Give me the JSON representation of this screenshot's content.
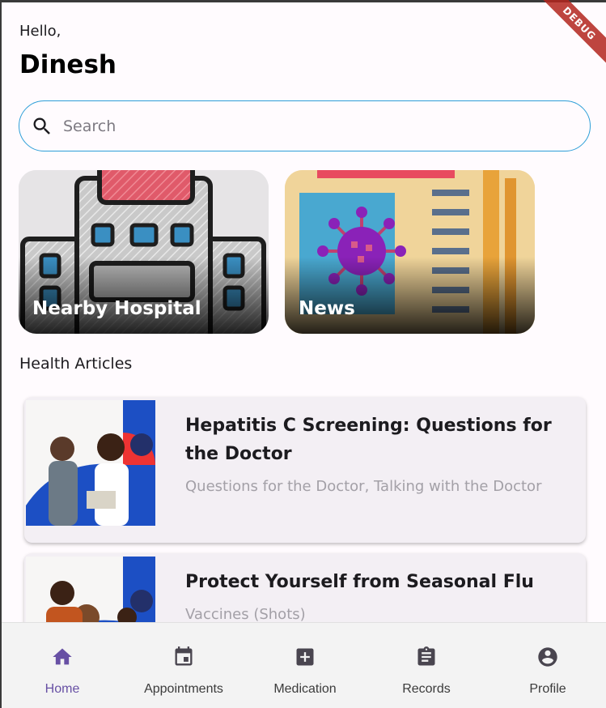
{
  "header": {
    "greeting": "Hello,",
    "name": "Dinesh",
    "debug_banner": "DEBUG"
  },
  "search": {
    "placeholder": "Search",
    "value": ""
  },
  "quick_links": [
    {
      "label": "Nearby Hospital",
      "icon": "hospital-illustration"
    },
    {
      "label": "News",
      "icon": "virus-news-illustration"
    }
  ],
  "articles_section": {
    "title": "Health Articles"
  },
  "articles": [
    {
      "title": "Hepatitis C Screening: Questions for the Doctor",
      "subtitle": "Questions for the Doctor, Talking with the Doctor"
    },
    {
      "title": "Protect Yourself from Seasonal Flu",
      "subtitle": "Vaccines (Shots)"
    }
  ],
  "nav": {
    "items": [
      {
        "label": "Home",
        "icon": "home-icon",
        "active": true
      },
      {
        "label": "Appointments",
        "icon": "calendar-icon",
        "active": false
      },
      {
        "label": "Medication",
        "icon": "medical-plus-icon",
        "active": false
      },
      {
        "label": "Records",
        "icon": "clipboard-icon",
        "active": false
      },
      {
        "label": "Profile",
        "icon": "account-circle-icon",
        "active": false
      }
    ]
  },
  "colors": {
    "accent": "#6750a4",
    "search_border": "#2e9fd8",
    "card_bg": "#f3eff4",
    "nav_bg": "#f3f3f3"
  }
}
